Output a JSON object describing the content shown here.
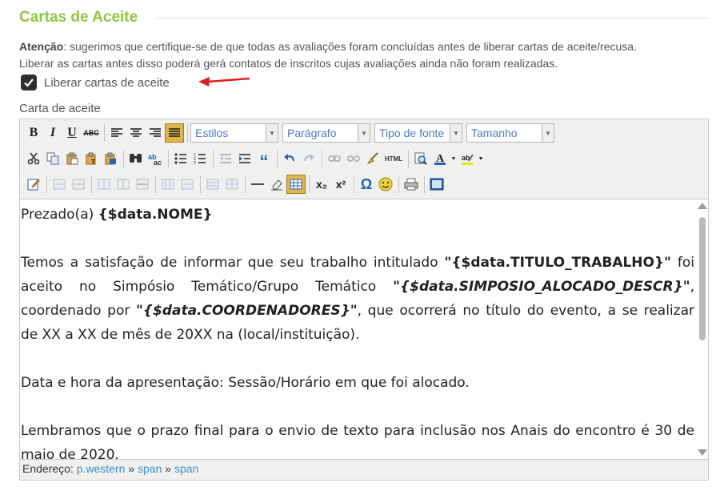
{
  "section": {
    "title": "Cartas de Aceite"
  },
  "notice": {
    "strong": "Atenção",
    "rest": ": sugerimos que certifique-se de que todas as avaliações foram concluídas antes de liberar cartas de aceite/recusa.",
    "line2": "Liberar as cartas antes disso poderá gerá contatos de inscritos cujas avaliações ainda não foram realizadas."
  },
  "release_checkbox": {
    "label": "Liberar cartas de aceite",
    "checked": true
  },
  "editor": {
    "label": "Carta de aceite",
    "toolbar": {
      "row1": {
        "bold": "B",
        "italic": "I",
        "underline": "U",
        "strike": "ABC",
        "styles": "Estilos",
        "format": "Parágrafo",
        "font": "Tipo de fonte",
        "size": "Tamanho"
      },
      "row2": {
        "blockquote": "“",
        "html": "HTML"
      },
      "row3": {
        "subscript": "x₂",
        "superscript": "x²",
        "omega": "Ω"
      }
    },
    "content": {
      "p1_text": "Prezado(a) ",
      "p1_var": "{$data.NOME}",
      "p2_a": "Temos a satisfação de informar que seu trabalho intitulado ",
      "p2_var1": "\"{$data.TITULO_TRABALHO}\"",
      "p2_b": " foi aceito no Simpósio Temático/Grupo Temático ",
      "p2_var2": "\"{$data.SIMPOSIO_ALOCADO_DESCR}\"",
      "p2_c": ", coordenado por ",
      "p2_var3": "\"{$data.COORDENADORES}\"",
      "p2_d": ", que ocorrerá no título do evento, a se realizar de XX a XX de mês de 20XX na (local/instituição).",
      "p3": "Data e hora da apresentação: Sessão/Horário em que foi alocado.",
      "p4": "Lembramos que o prazo final para o envio de texto para inclusão nos Anais do encontro é 30 de maio de 2020."
    },
    "status": {
      "label": "Endereço:",
      "path": [
        "p.western",
        "span",
        "span"
      ],
      "sep": "»"
    }
  },
  "colors": {
    "title": "#8dc63f",
    "arrow": "#e02020",
    "link": "#3f8fc8",
    "select_text": "#4a7dbd"
  }
}
